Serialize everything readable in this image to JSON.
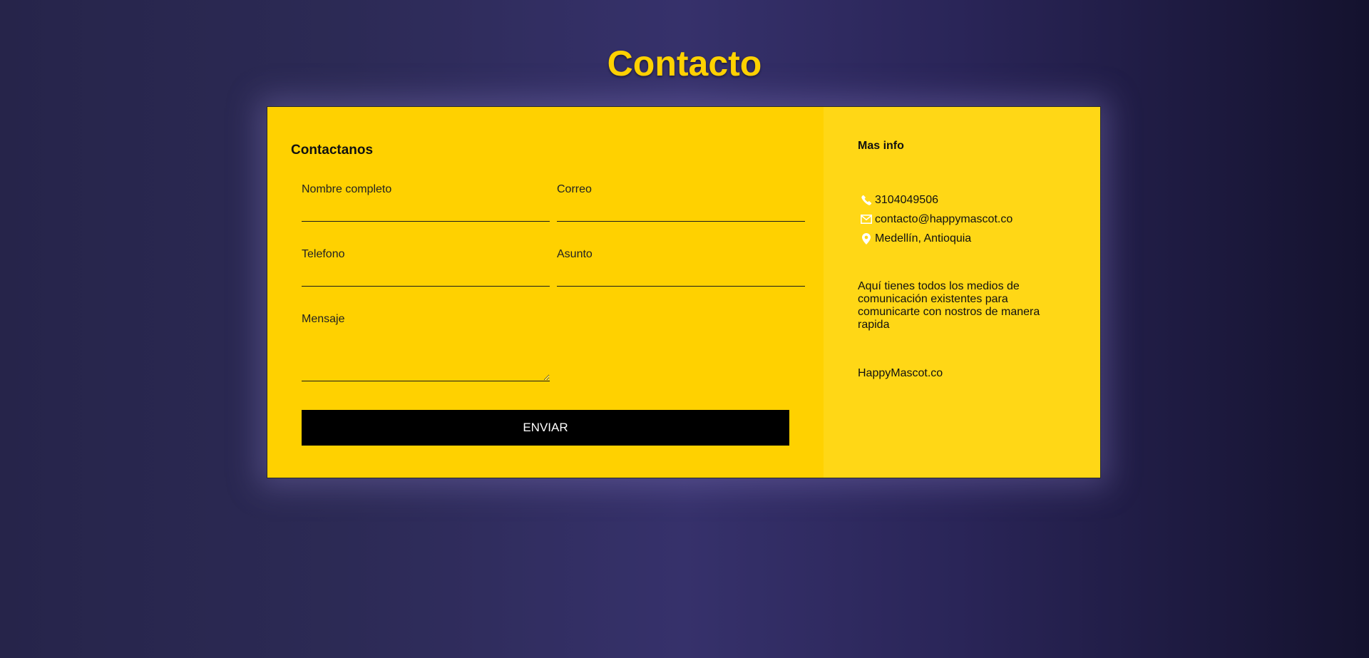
{
  "page": {
    "title": "Contacto",
    "accent_color": "#ffd200",
    "background_color": "#2c2a55"
  },
  "form": {
    "heading": "Contactanos",
    "fields": {
      "nombre": {
        "label": "Nombre completo",
        "value": ""
      },
      "correo": {
        "label": "Correo",
        "value": ""
      },
      "telefono": {
        "label": "Telefono",
        "value": ""
      },
      "asunto": {
        "label": "Asunto",
        "value": ""
      },
      "mensaje": {
        "label": "Mensaje",
        "value": ""
      }
    },
    "submit_label": "ENVIAR",
    "panel_color": "#ffd100"
  },
  "info": {
    "heading": "Mas info",
    "phone": {
      "icon": "phone-icon",
      "text": "3104049506"
    },
    "email": {
      "icon": "envelope-icon",
      "text": "contacto@happymascot.co"
    },
    "location": {
      "icon": "map-marker-icon",
      "text": "Medellín, Antioquia"
    },
    "description": "Aquí tienes todos los medios de comunicación existentes para comunicarte con nostros de manera rapida",
    "brand": "HappyMascot.co",
    "panel_color": "#ffd716"
  }
}
